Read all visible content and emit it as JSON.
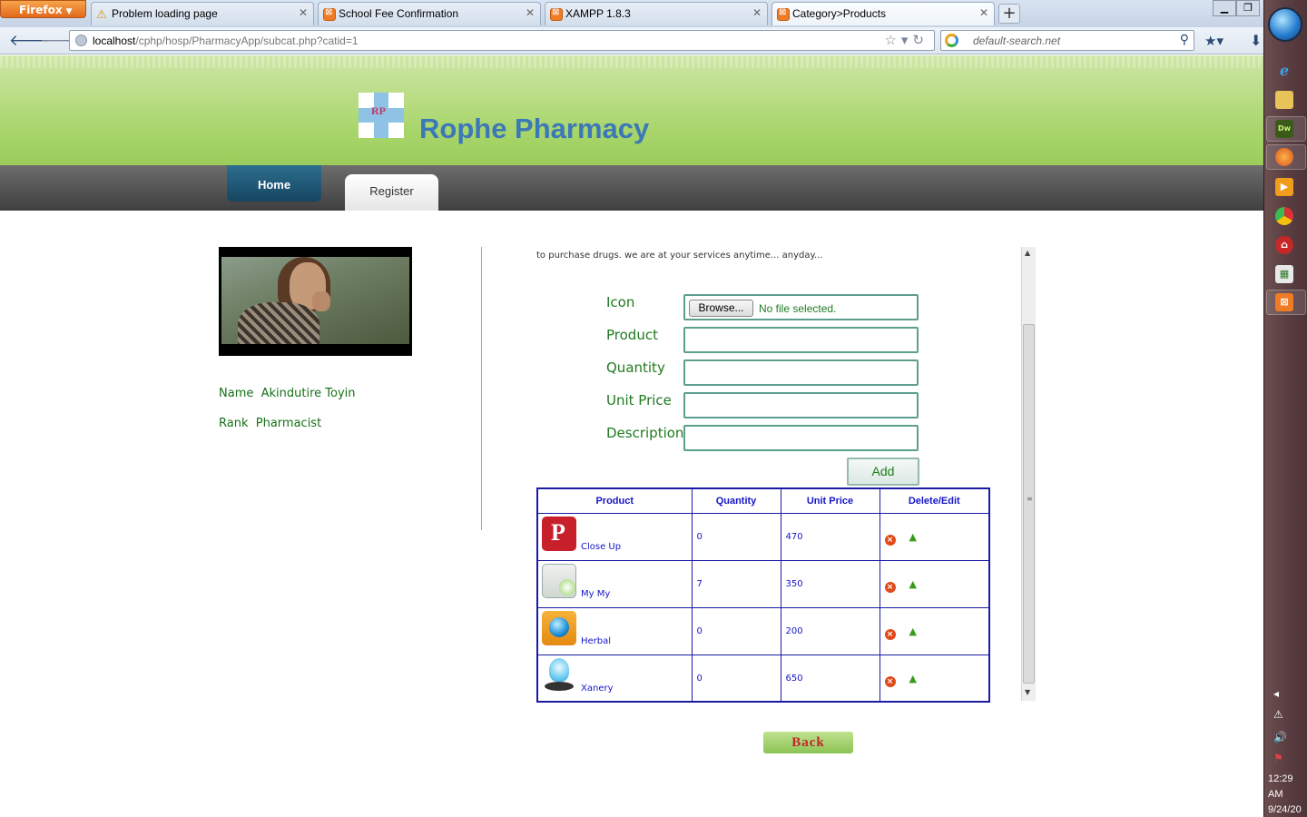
{
  "browser": {
    "app_button": "Firefox",
    "tabs": [
      {
        "label": "Problem loading page"
      },
      {
        "label": "School Fee Confirmation"
      },
      {
        "label": "XAMPP 1.8.3"
      },
      {
        "label": "Category>Products"
      }
    ],
    "url_host": "localhost",
    "url_path": "/cphp/hosp/PharmacyApp/subcat.php?catid=1",
    "search_placeholder": "default-search.net"
  },
  "site": {
    "title": "Rophe Pharmacy",
    "logo_mark": "RP",
    "menu": {
      "home": "Home",
      "register": "Register"
    }
  },
  "profile": {
    "name_label": "Name",
    "name_value": "Akindutire Toyin",
    "rank_label": "Rank",
    "rank_value": "Pharmacist"
  },
  "intro_text": "to purchase drugs. we are at your services anytime... anyday...",
  "form": {
    "icon_label": "Icon",
    "browse_label": "Browse...",
    "no_file": "No file selected.",
    "product_label": "Product",
    "quantity_label": "Quantity",
    "unit_price_label": "Unit Price",
    "description_label": "Description",
    "add_label": "Add"
  },
  "table": {
    "headers": [
      "Product",
      "Quantity",
      "Unit Price",
      "Delete/Edit"
    ],
    "rows": [
      {
        "name": "Close Up",
        "quantity": "0",
        "price": "470",
        "icon": "pinterest-icon"
      },
      {
        "name": "My My",
        "quantity": "7",
        "price": "350",
        "icon": "calendar-icon"
      },
      {
        "name": "Herbal",
        "quantity": "0",
        "price": "200",
        "icon": "globe-icon"
      },
      {
        "name": "Xanery",
        "quantity": "0",
        "price": "650",
        "icon": "lamp-icon"
      }
    ]
  },
  "back_label": "Back",
  "taskbar": {
    "time": "12:29 AM",
    "date": "9/24/20"
  }
}
